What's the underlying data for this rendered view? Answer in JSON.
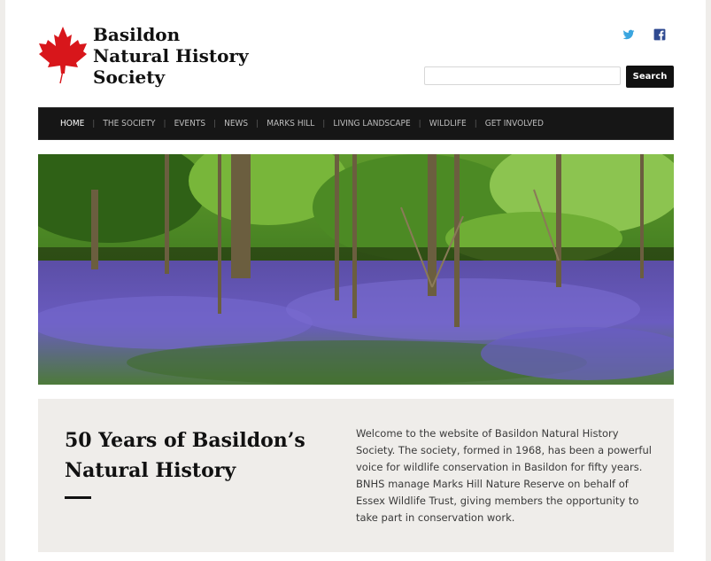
{
  "site": {
    "title_lines": [
      "Basildon",
      "Natural History",
      "Society"
    ],
    "logo_icon": "maple-leaf-icon",
    "logo_color": "#d8161b"
  },
  "social": [
    {
      "name": "twitter-icon",
      "color": "#3aa5df"
    },
    {
      "name": "facebook-icon",
      "color": "#2f4a91"
    }
  ],
  "search": {
    "placeholder": "",
    "value": "",
    "button_label": "Search"
  },
  "nav": {
    "items": [
      {
        "label": "HOME",
        "active": true
      },
      {
        "label": "THE SOCIETY",
        "active": false
      },
      {
        "label": "EVENTS",
        "active": false
      },
      {
        "label": "NEWS",
        "active": false
      },
      {
        "label": "MARKS HILL",
        "active": false
      },
      {
        "label": "LIVING LANDSCAPE",
        "active": false
      },
      {
        "label": "WILDLIFE",
        "active": false
      },
      {
        "label": "GET INVOLVED",
        "active": false
      }
    ],
    "separator": "|"
  },
  "intro": {
    "heading": "50 Years of Basildon’s Natural History",
    "text": "Welcome to the website of Basildon Natural History Society. The society, formed in 1968, has been a powerful voice for wildlife conservation in Basildon for fifty years. BNHS manage Marks Hill Nature Reserve on behalf of Essex Wildlife Trust, giving members the opportunity to take part in conservation work."
  }
}
